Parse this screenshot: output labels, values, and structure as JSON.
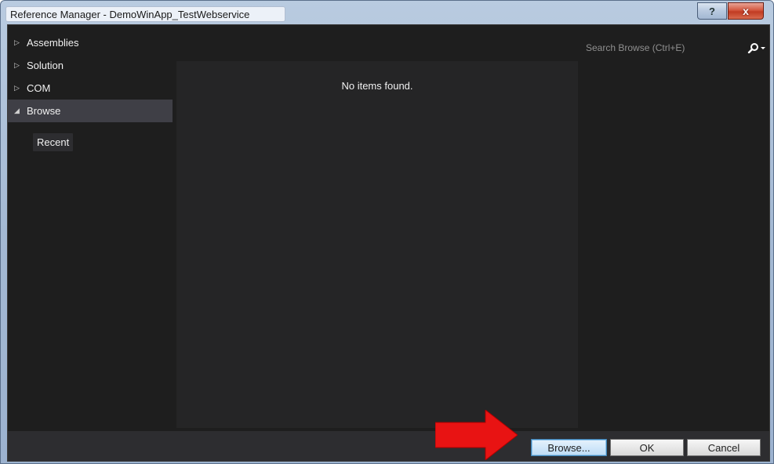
{
  "window": {
    "title": "Reference Manager - DemoWinApp_TestWebservice",
    "help_label": "?",
    "close_label": "x"
  },
  "sidebar": {
    "items": [
      {
        "label": "Assemblies",
        "arrow": "▷",
        "expanded": false
      },
      {
        "label": "Solution",
        "arrow": "▷",
        "expanded": false
      },
      {
        "label": "COM",
        "arrow": "▷",
        "expanded": false
      },
      {
        "label": "Browse",
        "arrow": "◢",
        "expanded": true
      }
    ],
    "sub_item": {
      "label": "Recent"
    }
  },
  "main": {
    "empty_message": "No items found."
  },
  "search": {
    "placeholder": "Search Browse (Ctrl+E)",
    "icon": "search-icon"
  },
  "footer": {
    "browse_label": "Browse...",
    "ok_label": "OK",
    "cancel_label": "Cancel"
  },
  "colors": {
    "annotation_arrow": "#e81313",
    "background": "#1e1e1e",
    "panel": "#252526",
    "selected": "#3f3f46"
  }
}
